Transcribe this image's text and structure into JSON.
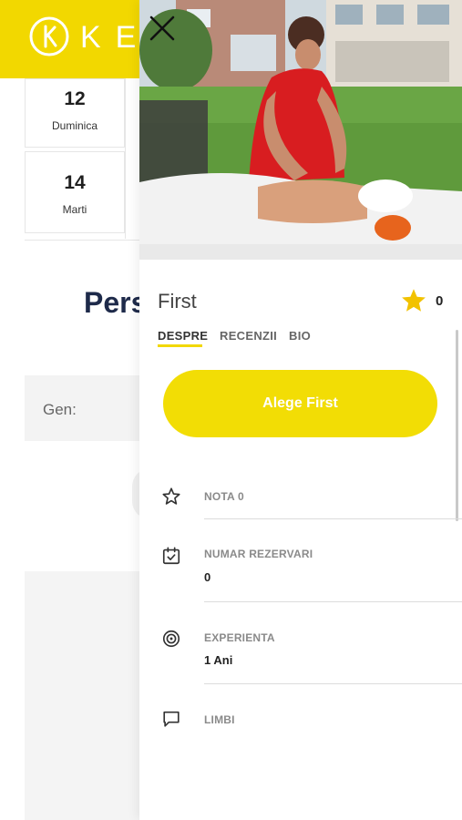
{
  "header": {
    "logo_text": "KE"
  },
  "calendar": {
    "days": [
      {
        "num": "12",
        "name": "Duminica"
      },
      {
        "num": "14",
        "name": "Marti"
      }
    ]
  },
  "background": {
    "heading": "Pers",
    "gender_label": "Gen:"
  },
  "therapist": {
    "name": "First",
    "rating": "0",
    "tabs": [
      "DESPRE",
      "RECENZII",
      "BIO"
    ],
    "choose_button": "Alege First",
    "info": [
      {
        "label": "NOTA 0",
        "value": "",
        "icon": "star-outline-icon"
      },
      {
        "label": "NUMAR REZERVARI",
        "value": "0",
        "icon": "calendar-check-icon"
      },
      {
        "label": "EXPERIENTA",
        "value": "1 Ani",
        "icon": "target-icon"
      },
      {
        "label": "LIMBI",
        "value": "",
        "icon": "chat-bubble-icon"
      }
    ]
  },
  "colors": {
    "accent": "#f2d800",
    "star": "#f2c200",
    "heading": "#1e2a4a"
  }
}
